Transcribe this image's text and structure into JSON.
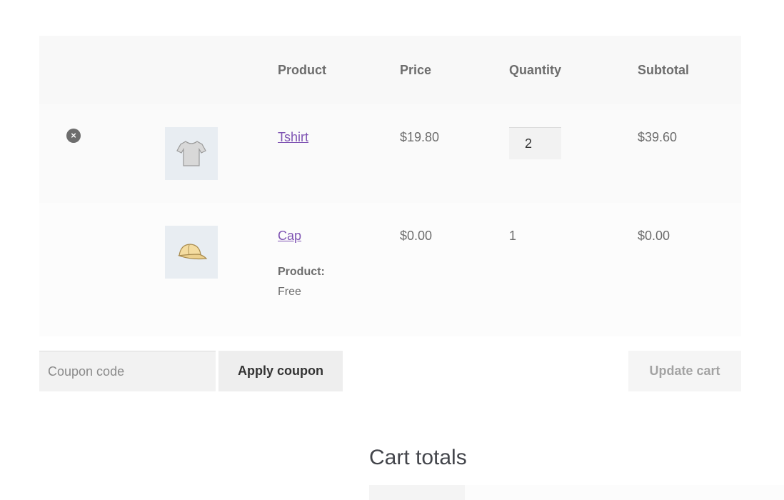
{
  "table": {
    "headers": {
      "product": "Product",
      "price": "Price",
      "quantity": "Quantity",
      "subtotal": "Subtotal"
    },
    "rows": [
      {
        "remove_glyph": "×",
        "product_name": "Tshirt",
        "thumbnail_icon": "tshirt-icon",
        "price": "$19.80",
        "quantity": "2",
        "subtotal": "$39.60"
      },
      {
        "product_name": "Cap",
        "thumbnail_icon": "cap-icon",
        "price": "$0.00",
        "quantity": "1",
        "subtotal": "$0.00",
        "meta_label": "Product:",
        "meta_value": "Free"
      }
    ]
  },
  "actions": {
    "coupon_placeholder": "Coupon code",
    "apply_coupon_label": "Apply coupon",
    "update_cart_label": "Update cart"
  },
  "totals": {
    "title": "Cart totals"
  },
  "colors": {
    "link": "#7f54b3",
    "text": "#6d6d6d",
    "heading": "#43454b"
  }
}
